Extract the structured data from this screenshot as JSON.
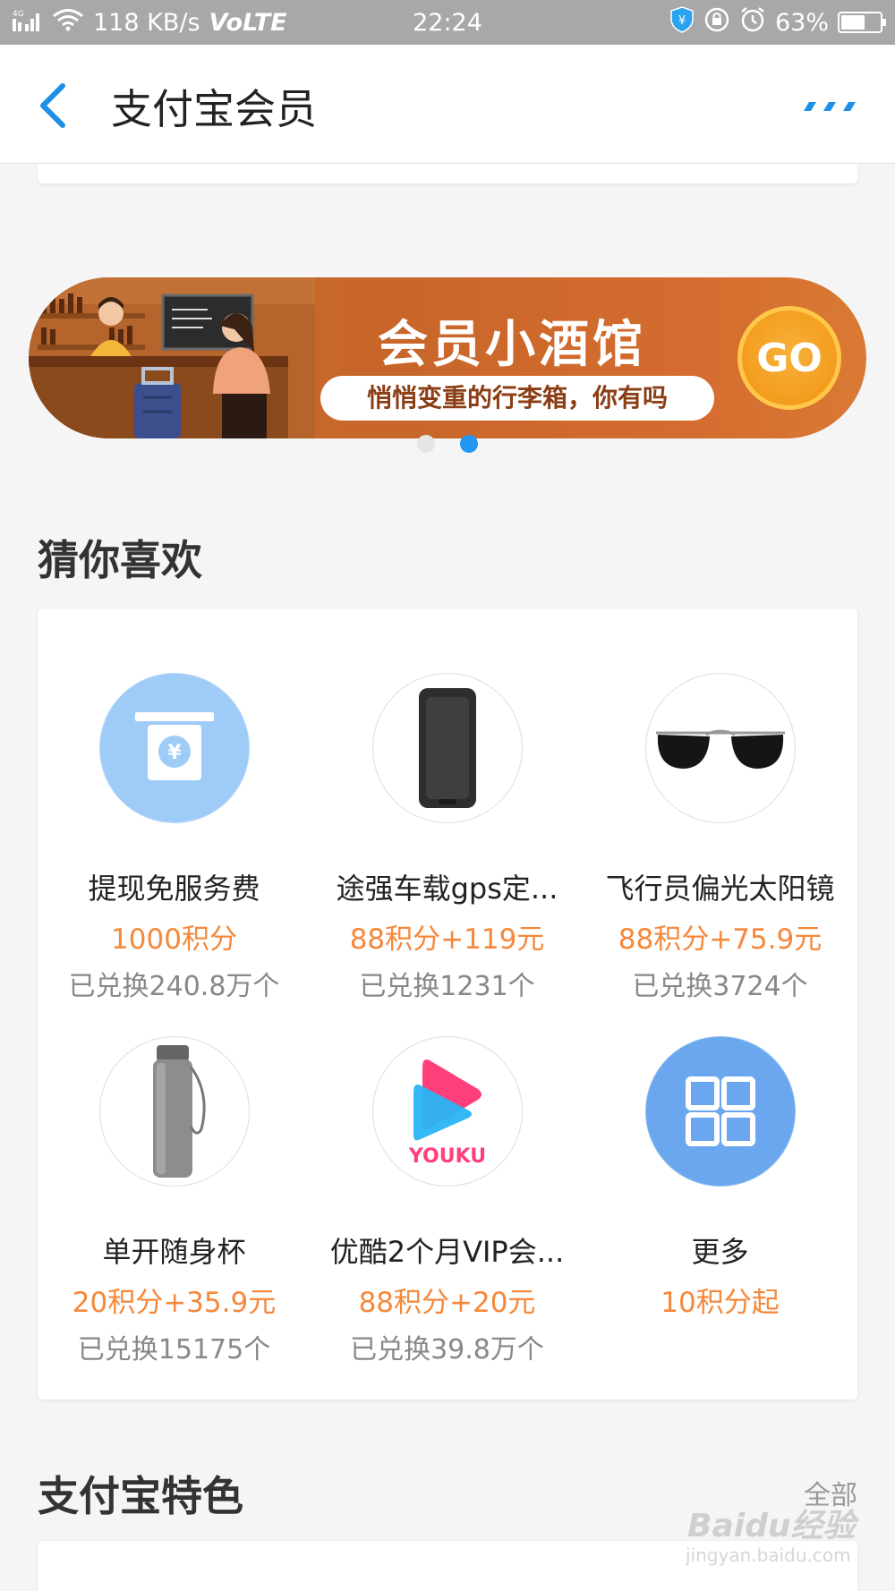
{
  "status_bar": {
    "network": "4G",
    "speed": "118 KB/s",
    "volte": "VoLTE",
    "time": "22:24",
    "battery_text": "63%",
    "battery_level": 0.63
  },
  "nav": {
    "title": "支付宝会员"
  },
  "banner": {
    "title": "会员小酒馆",
    "subtitle": "悄悄变重的行李箱，你有吗",
    "go_label": "GO",
    "active_index": 1,
    "colors": {
      "start": "#c86a2a",
      "end": "#d97a34"
    }
  },
  "recommend": {
    "title": "猜你喜欢",
    "items": [
      {
        "name": "提现免服务费",
        "price": "1000积分",
        "sold": "已兑换240.8万个",
        "icon": "withdraw-icon"
      },
      {
        "name": "途强车载gps定...",
        "price": "88积分+119元",
        "sold": "已兑换1231个",
        "icon": "gps-tracker-image"
      },
      {
        "name": "飞行员偏光太阳镜",
        "price": "88积分+75.9元",
        "sold": "已兑换3724个",
        "icon": "sunglasses-image"
      },
      {
        "name": "单开随身杯",
        "price": "20积分+35.9元",
        "sold": "已兑换15175个",
        "icon": "water-bottle-image"
      },
      {
        "name": "优酷2个月VIP会...",
        "price": "88积分+20元",
        "sold": "已兑换39.8万个",
        "icon": "youku-logo",
        "logo_text": "YOUKU"
      },
      {
        "name": "更多",
        "price": "10积分起",
        "sold": "",
        "icon": "grid-icon"
      }
    ]
  },
  "features": {
    "title": "支付宝特色",
    "see_all": "全部"
  },
  "watermark": {
    "brand": "Baidu经验",
    "url": "jingyan.baidu.com"
  },
  "colors": {
    "accent_blue": "#2196f3",
    "price_orange": "#f5883a"
  }
}
